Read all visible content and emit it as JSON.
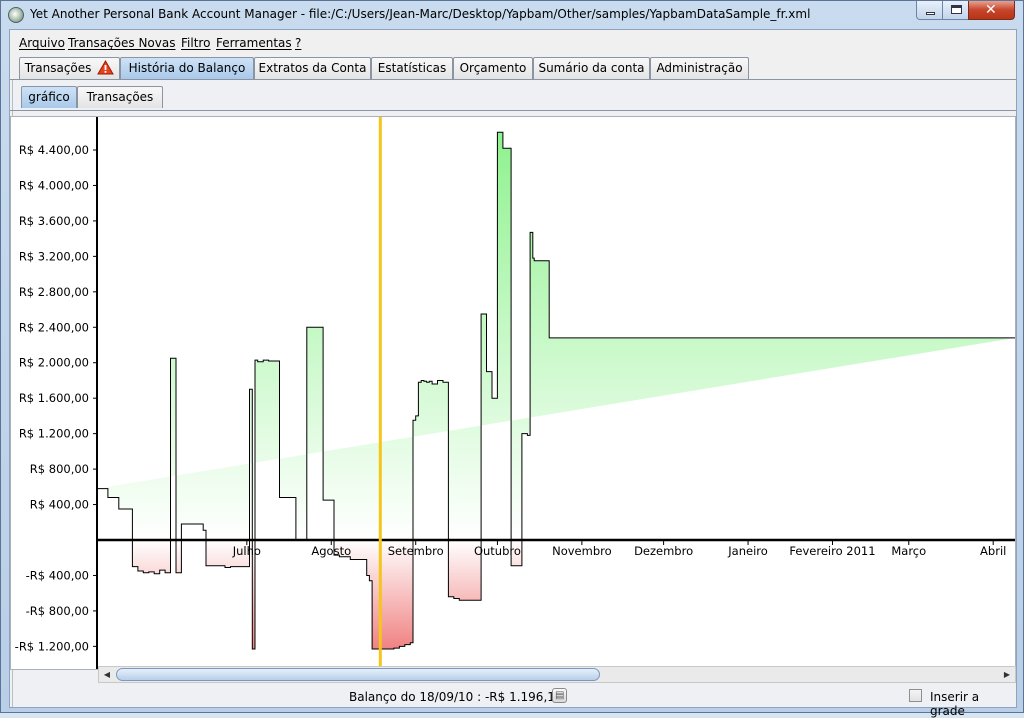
{
  "window": {
    "title": "Yet Another Personal Bank Account Manager - file:/C:/Users/Jean-Marc/Desktop/Yapbam/Other/samples/YapbamDataSample_fr.xml",
    "controls": [
      "minimize",
      "maximize",
      "close"
    ]
  },
  "menu": [
    "Arquivo",
    "Transações Novas",
    "Filtro",
    "Ferramentas",
    "?"
  ],
  "tabs": [
    {
      "label": "Transações",
      "icon": "warning-icon",
      "selected": false
    },
    {
      "label": "História do Balanço",
      "selected": true
    },
    {
      "label": "Extratos da Conta",
      "selected": false
    },
    {
      "label": "Estatísticas",
      "selected": false
    },
    {
      "label": "Orçamento",
      "selected": false
    },
    {
      "label": "Sumário da conta",
      "selected": false
    },
    {
      "label": "Administração",
      "selected": false
    }
  ],
  "subtabs": [
    {
      "label": "gráfico",
      "selected": true
    },
    {
      "label": "Transações",
      "selected": false
    }
  ],
  "chart_data": {
    "type": "area",
    "step": true,
    "y_tick_labels": [
      "R$ 4.400,00",
      "R$ 4.000,00",
      "R$ 3.600,00",
      "R$ 3.200,00",
      "R$ 2.800,00",
      "R$ 2.400,00",
      "R$ 2.000,00",
      "R$ 1.600,00",
      "R$ 1.200,00",
      "R$ 800,00",
      "R$ 400,00",
      "-R$ 400,00",
      "-R$ 800,00",
      "-R$ 1.200,00"
    ],
    "y_ticks": [
      4400,
      4000,
      3600,
      3200,
      2800,
      2400,
      2000,
      1600,
      1200,
      800,
      400,
      -400,
      -800,
      -1200
    ],
    "x_tick_labels": [
      "Julho",
      "Agosto",
      "Setembro",
      "Outubro",
      "Novembro",
      "Dezembro",
      "Janeiro",
      "Fevereiro 2011",
      "Março",
      "Abril"
    ],
    "x_ticks": [
      30,
      61,
      92,
      122,
      153,
      183,
      214,
      245,
      273,
      304
    ],
    "ylim": [
      -1400,
      4700
    ],
    "xlim": [
      -25,
      312
    ],
    "positive_color": "#8ff28f",
    "negative_color": "#f08080",
    "marker_color": "#f5c518",
    "marker_x": 79,
    "x": [
      -25,
      -21,
      -17,
      -12,
      -10,
      -8,
      -6,
      -4,
      -2,
      0,
      2,
      4,
      6,
      8,
      10,
      12,
      14,
      15,
      16,
      20,
      22,
      24,
      26,
      28,
      31,
      32,
      33,
      34,
      36,
      38,
      40,
      42,
      44,
      46,
      48,
      49,
      49.6,
      50,
      50.3,
      51,
      52,
      55,
      58,
      60,
      62,
      64,
      66,
      68,
      70,
      72,
      74,
      75,
      76,
      78,
      80,
      82,
      84,
      86,
      88,
      89,
      90,
      91,
      92,
      93,
      94,
      95,
      96,
      97,
      98,
      100,
      101,
      102,
      104,
      106,
      108,
      110,
      113,
      116,
      118,
      120,
      122,
      124,
      127,
      131,
      133,
      133.7,
      134,
      134.6,
      135,
      135.5,
      137,
      141,
      148,
      162,
      177,
      199,
      210,
      217,
      230,
      240,
      255,
      262,
      271,
      281,
      291,
      301,
      309,
      312
    ],
    "y": [
      580,
      480,
      350,
      -300,
      -350,
      -370,
      -360,
      -380,
      -340,
      -370,
      2050,
      -370,
      180,
      180,
      180,
      180,
      110,
      -290,
      -290,
      -290,
      -310,
      -300,
      -300,
      -300,
      1700,
      -1230,
      2030,
      2010,
      2030,
      2020,
      2020,
      480,
      480,
      480,
      0,
      0,
      0,
      0,
      0,
      0,
      2400,
      2400,
      450,
      450,
      -170,
      -190,
      -190,
      -220,
      -220,
      -220,
      -400,
      -460,
      -1230,
      -1230,
      -1230,
      -1230,
      -1220,
      -1200,
      -1180,
      -1180,
      -1160,
      1350,
      1400,
      1780,
      1800,
      1790,
      1780,
      1790,
      1760,
      1800,
      1800,
      1780,
      -640,
      -660,
      -680,
      -680,
      -680,
      2550,
      1900,
      1600,
      4600,
      4420,
      -290,
      1200,
      1180,
      1180,
      3470,
      3470,
      3180,
      3150,
      3150,
      2280,
      2280,
      2280,
      2280,
      2280,
      2280,
      2280,
      2280,
      2280,
      2280,
      2280,
      2280,
      2280,
      2280,
      2280,
      2280
    ],
    "grid": false,
    "legend": "none"
  },
  "status": {
    "text": "Balanço do 18/09/10 : -R$ 1.196,10",
    "icon": "calendar-icon"
  },
  "grid_toggle": {
    "label": "Inserir a grade",
    "checked": false
  }
}
